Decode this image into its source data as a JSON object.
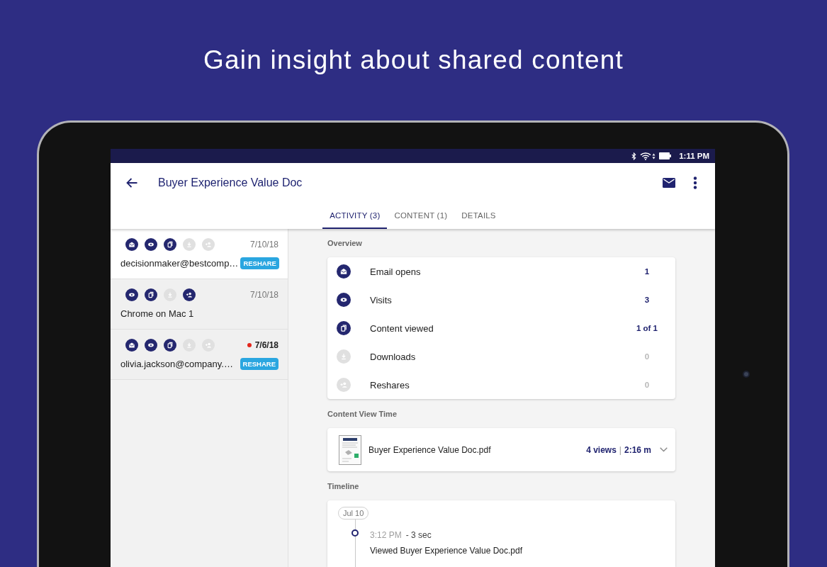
{
  "headline": "Gain insight about shared content",
  "status_bar": {
    "time": "1:11 PM"
  },
  "app_bar": {
    "title": "Buyer Experience Value Doc"
  },
  "tabs": [
    {
      "label": "ACTIVITY (3)",
      "selected": true
    },
    {
      "label": "CONTENT (1)",
      "selected": false
    },
    {
      "label": "DETAILS",
      "selected": false
    }
  ],
  "recipients": [
    {
      "selected": true,
      "unread": false,
      "date": "7/10/18",
      "name": "decisionmaker@bestcomp…",
      "badge": "RESHARE",
      "events": [
        {
          "kind": "email",
          "active": true
        },
        {
          "kind": "visit",
          "active": true
        },
        {
          "kind": "content",
          "active": true
        },
        {
          "kind": "download",
          "active": false
        },
        {
          "kind": "reshare",
          "active": false
        }
      ]
    },
    {
      "selected": false,
      "unread": false,
      "date": "7/10/18",
      "name": "Chrome on Mac 1",
      "events": [
        {
          "kind": "visit",
          "active": true
        },
        {
          "kind": "content",
          "active": true
        },
        {
          "kind": "download",
          "active": false
        },
        {
          "kind": "reshare",
          "active": true
        }
      ]
    },
    {
      "selected": false,
      "unread": true,
      "date": "7/6/18",
      "name": "olivia.jackson@company.…",
      "badge": "RESHARE",
      "events": [
        {
          "kind": "email",
          "active": true
        },
        {
          "kind": "visit",
          "active": true
        },
        {
          "kind": "content",
          "active": true
        },
        {
          "kind": "download",
          "active": false
        },
        {
          "kind": "reshare",
          "active": false
        }
      ]
    }
  ],
  "overview": {
    "title": "Overview",
    "rows": [
      {
        "kind": "email",
        "label": "Email opens",
        "value": "1",
        "active": true
      },
      {
        "kind": "visit",
        "label": "Visits",
        "value": "3",
        "active": true
      },
      {
        "kind": "content",
        "label": "Content viewed",
        "value": "1 of 1",
        "active": true
      },
      {
        "kind": "download",
        "label": "Downloads",
        "value": "0",
        "active": false
      },
      {
        "kind": "reshare",
        "label": "Reshares",
        "value": "0",
        "active": false
      }
    ]
  },
  "content_view_time": {
    "title": "Content View Time",
    "items": [
      {
        "file": "Buyer Experience Value Doc.pdf",
        "views": "4 views",
        "separator": "|",
        "duration": "2:16 m",
        "expanded": false
      }
    ]
  },
  "timeline": {
    "title": "Timeline",
    "days": [
      {
        "date": "Jul 10",
        "events": [
          {
            "time": "3:12 PM",
            "duration": "- 3 sec",
            "description": "Viewed Buyer Experience Value Doc.pdf"
          }
        ]
      }
    ]
  }
}
